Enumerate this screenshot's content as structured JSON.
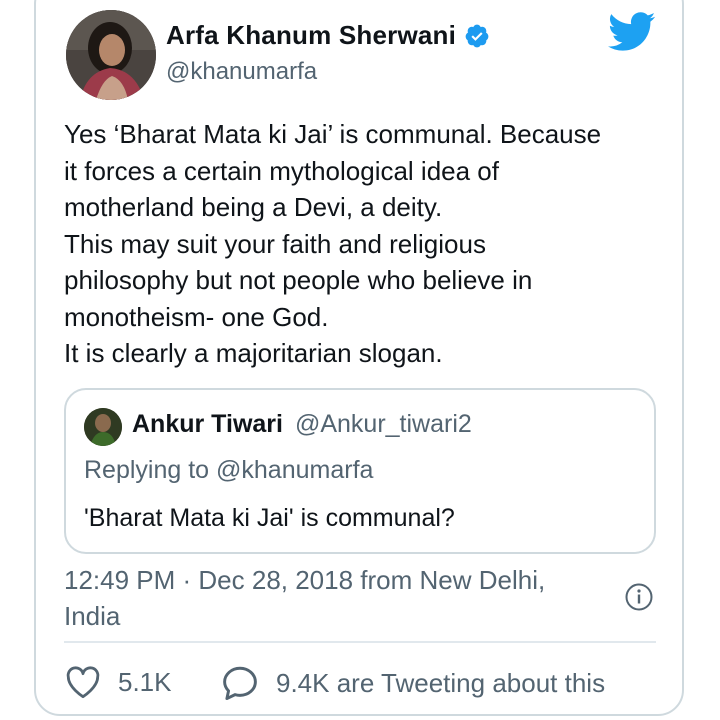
{
  "author": {
    "name": "Arfa Khanum Sherwani",
    "handle": "@khanumarfa",
    "avatar_icon": "profile-photo",
    "verified_icon": "verified-badge-icon"
  },
  "brand": {
    "logo": "twitter-bird-icon",
    "color": "#1da1f2"
  },
  "tweet": {
    "text": "Yes ‘Bharat Mata ki Jai’ is communal. Because\nit forces a certain mythological idea of\nmotherland being a Devi, a deity.\nThis may suit your faith and religious\nphilosophy but not people who believe in\nmonotheism- one God.\nIt is clearly a majoritarian slogan."
  },
  "quoted_tweet": {
    "name": "Ankur Tiwari",
    "handle": "@Ankur_tiwari2",
    "replying_to": "Replying to @khanumarfa",
    "text": "'Bharat Mata ki Jai' is communal?"
  },
  "meta": {
    "timestamp_location": "12:49 PM · Dec 28, 2018 from New Delhi,\nIndia",
    "info_icon": "info-icon"
  },
  "stats": {
    "likes": "5.1K",
    "conversation": "9.4K are Tweeting about this"
  },
  "colors": {
    "text": "#0f1419",
    "secondary": "#536471",
    "border": "#cfd9de"
  }
}
